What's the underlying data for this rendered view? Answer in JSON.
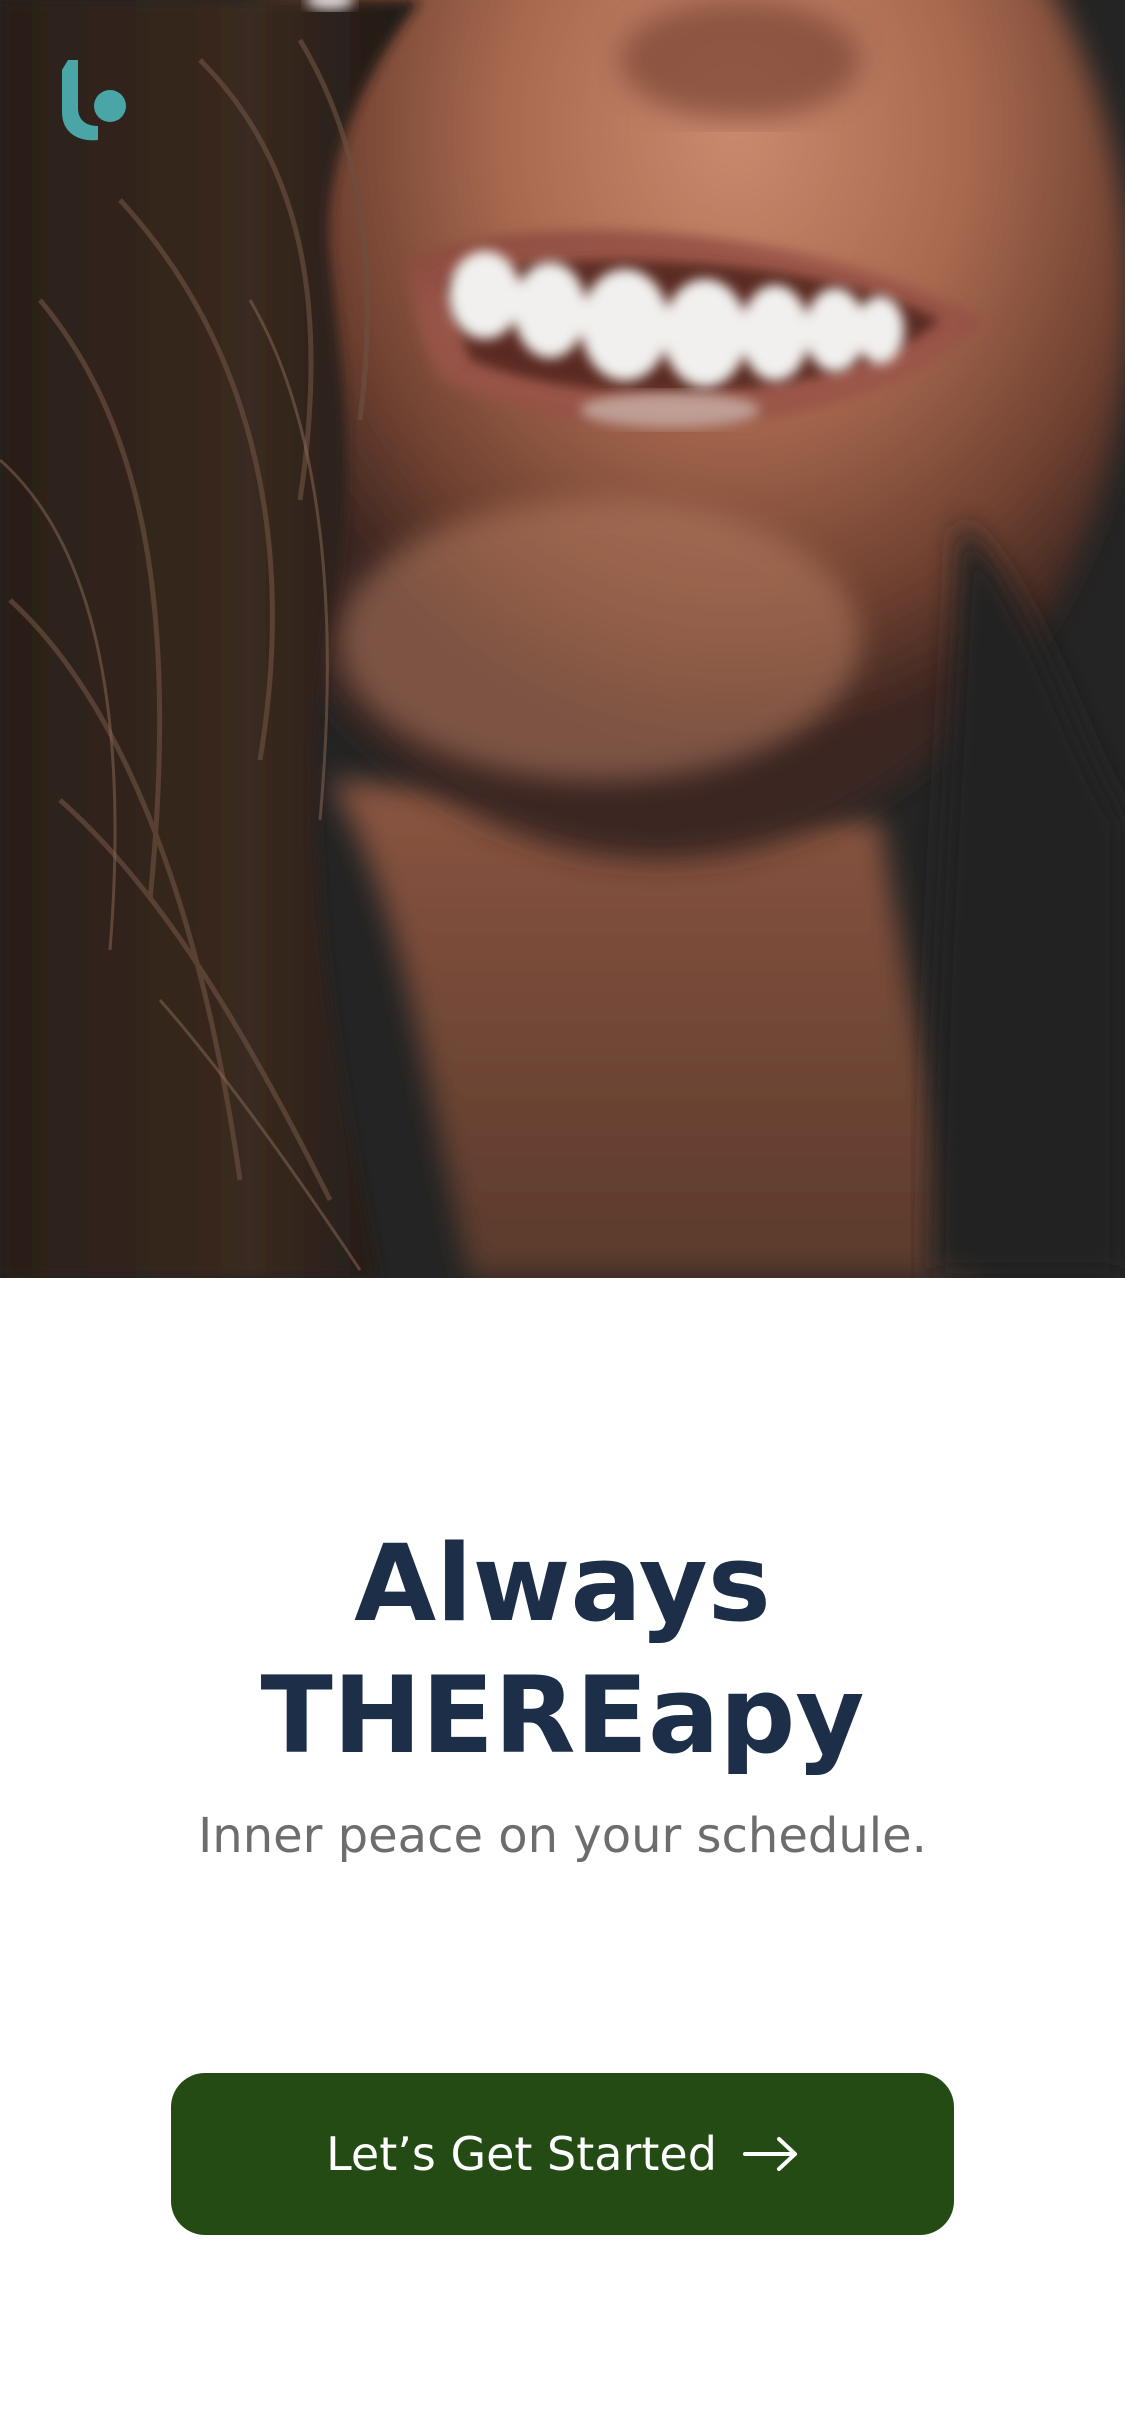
{
  "hero": {
    "image_icon": "smiling-woman-photo",
    "logo_icon": "brand-logo-icon",
    "logo_color": "#4aa5a6"
  },
  "content": {
    "title_line1": "Always",
    "title_line2": "THEREapy",
    "subtitle": "Inner peace on your schedule."
  },
  "cta": {
    "label": "Let’s Get Started",
    "icon": "arrow-right-icon",
    "color": "#244b14"
  },
  "colors": {
    "title": "#1c2e48",
    "subtitle": "#6d6d6d",
    "background": "#ffffff"
  }
}
